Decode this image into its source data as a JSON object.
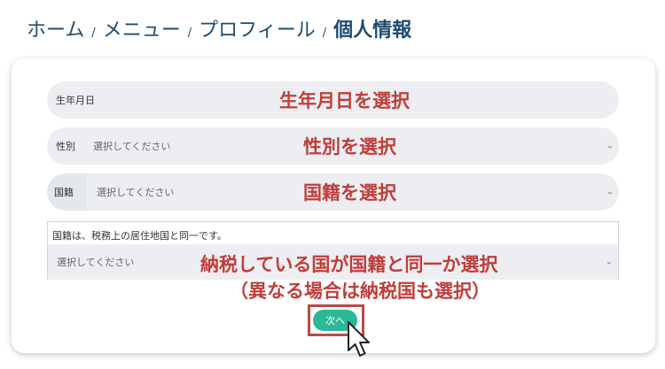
{
  "breadcrumb": {
    "items": [
      "ホーム",
      "メニュー",
      "プロフィール"
    ],
    "current": "個人情報",
    "separator": "/"
  },
  "form": {
    "birthdate": {
      "label": "生年月日"
    },
    "gender": {
      "label": "性別",
      "placeholder": "選択してください"
    },
    "nationality": {
      "label": "国籍",
      "placeholder": "選択してください"
    },
    "tax_residence": {
      "note": "国籍は、税務上の居住地国と同一です。",
      "placeholder": "選択してください"
    },
    "next_button": "次へ"
  },
  "annotations": {
    "birthdate": "生年月日を選択",
    "gender": "性別を選択",
    "nationality": "国籍を選択",
    "tax_line1": "納税している国が国籍と同一か選択",
    "tax_line2": "（異なる場合は納税国も選択）"
  },
  "icons": {
    "dropdown": "chevron-down-icon",
    "cursor": "mouse-pointer-icon"
  },
  "colors": {
    "brand_text": "#1f4c6e",
    "annotation": "#c03d3a",
    "accent_green": "#2bb896",
    "highlight_border": "#b94a46"
  }
}
